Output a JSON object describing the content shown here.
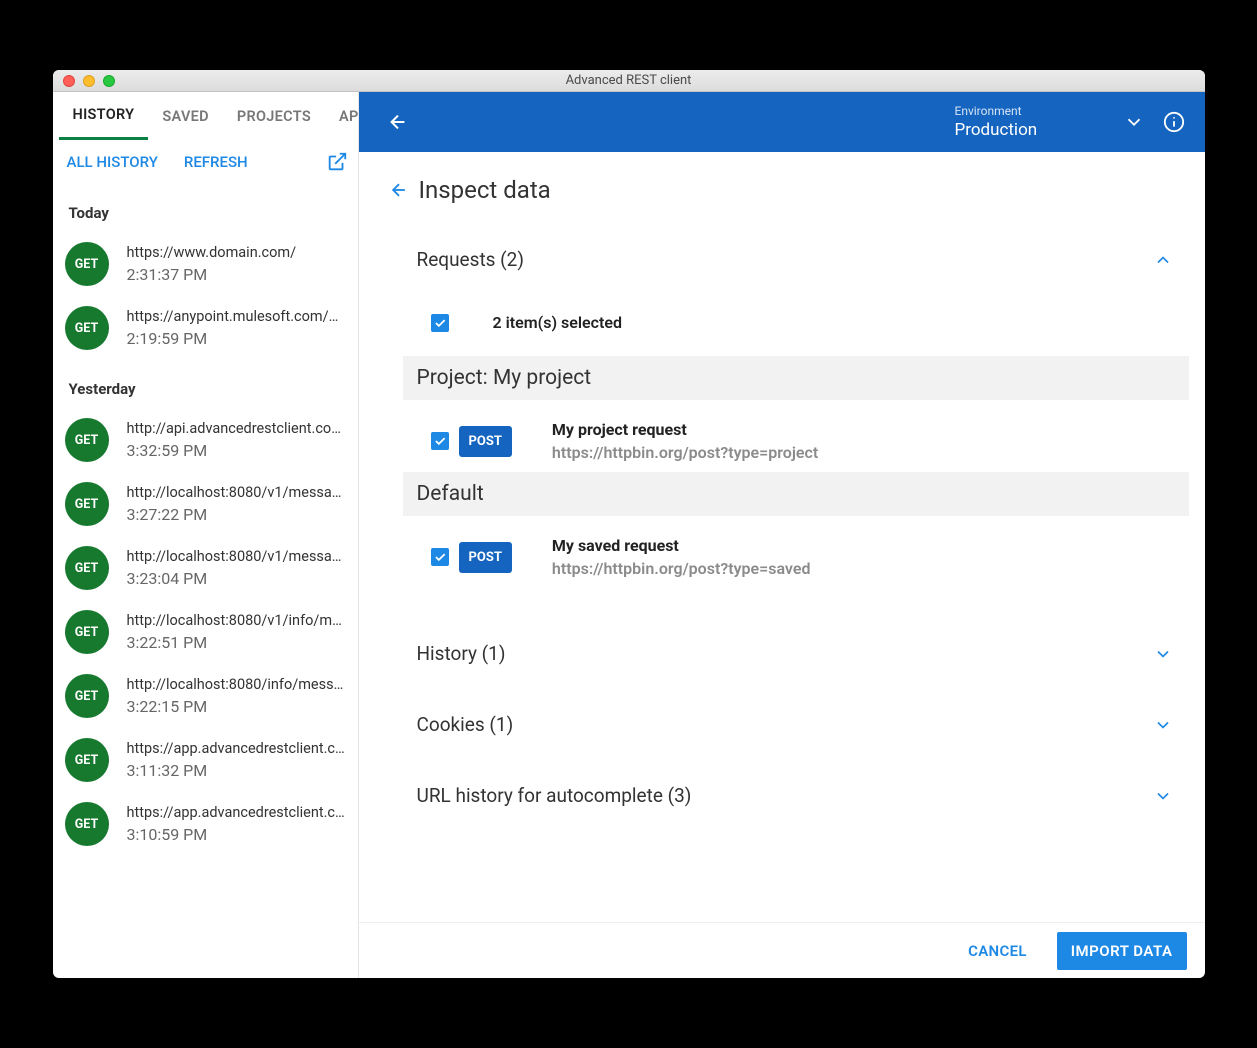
{
  "window": {
    "title": "Advanced REST client"
  },
  "sidebar": {
    "tabs": [
      "HISTORY",
      "SAVED",
      "PROJECTS",
      "APIS"
    ],
    "active_tab": 0,
    "all_history": "ALL HISTORY",
    "refresh": "REFRESH",
    "days": [
      {
        "label": "Today",
        "items": [
          {
            "method": "GET",
            "url": "https://www.domain.com/",
            "time": "2:31:37 PM"
          },
          {
            "method": "GET",
            "url": "https://anypoint.mulesoft.com/ho...",
            "time": "2:19:59 PM"
          }
        ]
      },
      {
        "label": "Yesterday",
        "items": [
          {
            "method": "GET",
            "url": "http://api.advancedrestclient.com...",
            "time": "3:32:59 PM"
          },
          {
            "method": "GET",
            "url": "http://localhost:8080/v1/message...",
            "time": "3:27:22 PM"
          },
          {
            "method": "GET",
            "url": "http://localhost:8080/v1/message...",
            "time": "3:23:04 PM"
          },
          {
            "method": "GET",
            "url": "http://localhost:8080/v1/info/mes...",
            "time": "3:22:51 PM"
          },
          {
            "method": "GET",
            "url": "http://localhost:8080/info/messa...",
            "time": "3:22:15 PM"
          },
          {
            "method": "GET",
            "url": "https://app.advancedrestclient.co...",
            "time": "3:11:32 PM"
          },
          {
            "method": "GET",
            "url": "https://app.advancedrestclient.co...",
            "time": "3:10:59 PM"
          }
        ]
      }
    ]
  },
  "topbar": {
    "env_label": "Environment",
    "env_value": "Production"
  },
  "page": {
    "title": "Inspect data",
    "sections": {
      "requests": {
        "title": "Requests (2)",
        "selected_text": "2 item(s) selected",
        "groups": [
          {
            "title": "Project: My project",
            "items": [
              {
                "method": "POST",
                "name": "My project request",
                "url": "https://httpbin.org/post?type=project"
              }
            ]
          },
          {
            "title": "Default",
            "items": [
              {
                "method": "POST",
                "name": "My saved request",
                "url": "https://httpbin.org/post?type=saved"
              }
            ]
          }
        ]
      },
      "history": {
        "title": "History (1)"
      },
      "cookies": {
        "title": "Cookies (1)"
      },
      "url_history": {
        "title": "URL history for autocomplete (3)"
      }
    },
    "footer": {
      "cancel": "CANCEL",
      "import": "IMPORT DATA"
    }
  }
}
